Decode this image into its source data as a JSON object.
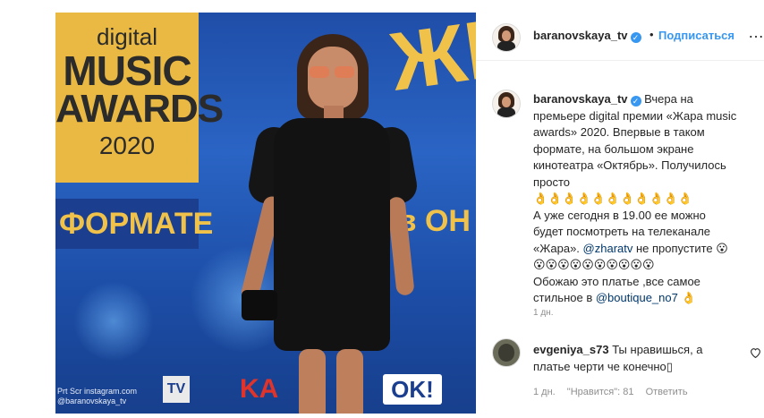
{
  "photo": {
    "backdrop": {
      "logo_line1": "digital",
      "logo_line2": "MUSIC",
      "logo_line3": "AWARDS",
      "logo_year": "2020",
      "formate": "ФОРМАТЕ",
      "zhara": "ЖР",
      "von": "в ОН"
    },
    "watermark_line1": "Prt Scr instagram.com",
    "watermark_line2": "@baranovskaya_tv",
    "sponsor_tv": "TV",
    "sponsor_ka": "KA",
    "sponsor_ok": "OK!"
  },
  "header": {
    "username": "baranovskaya_tv",
    "verified": "✓",
    "separator": "•",
    "follow_label": "Подписаться",
    "more_icon": "…"
  },
  "caption": {
    "username": "baranovskaya_tv",
    "verified": "✓",
    "text_part1": " Вчера на премьере digital премии «Жара music awards» 2020. Впервые в таком формате, на большом экране кинотеатра «Октябрь». Получилось просто",
    "emoji_row1": "👌👌👌👌👌👌👌👌👌👌👌",
    "text_part2": "А уже сегодня в 19.00 ее можно будет посмотреть на телеканале «Жара».",
    "mention1": "@zharatv",
    "text_part3": " не пропустите 😮",
    "emoji_row2": "😮😮😮😮😮😮😮😮😮😮",
    "text_part4": "Обожаю это платье ,все самое стильное в ",
    "mention2": "@boutique_no7",
    "text_part5": " 👌",
    "time": "1 дн."
  },
  "comment": {
    "username": "evgeniya_s73",
    "text": " Ты нравишься, а платье черти че конечно",
    "trailing_glyph": "▯",
    "time": "1 дн.",
    "likes": "\"Нравится\": 81",
    "reply": "Ответить"
  }
}
